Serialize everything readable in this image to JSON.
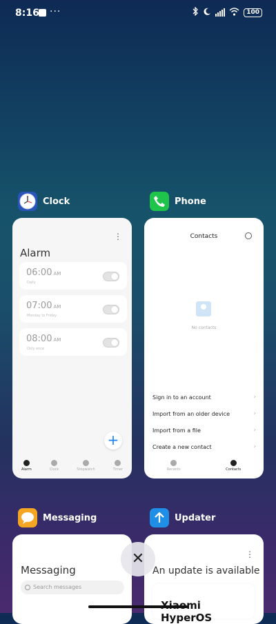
{
  "status_bar": {
    "time": "8:16",
    "dots": "···",
    "battery": "100"
  },
  "apps": [
    {
      "name": "Clock",
      "icon": "clock-icon",
      "card": {
        "title": "Alarm",
        "more": "⋮",
        "alarms": [
          {
            "time": "06:00",
            "ampm": "AM",
            "sub": "Daily"
          },
          {
            "time": "07:00",
            "ampm": "AM",
            "sub": "Monday to Friday"
          },
          {
            "time": "08:00",
            "ampm": "AM",
            "sub": "Only once"
          }
        ],
        "add_label": "+",
        "tabs": [
          "Alarm",
          "Clock",
          "Stopwatch",
          "Timer"
        ],
        "active_tab": "Alarm"
      }
    },
    {
      "name": "Phone",
      "icon": "phone-icon",
      "card": {
        "title": "Contacts",
        "empty_text": "No contacts",
        "menu": [
          "Sign in to an account",
          "Import from an older device",
          "Import from a file",
          "Create a new contact"
        ],
        "tabs": [
          "Recents",
          "Contacts"
        ],
        "active_tab": "Contacts"
      }
    },
    {
      "name": "Messaging",
      "icon": "messaging-icon",
      "card": {
        "title": "Messaging",
        "search_placeholder": "Search messages"
      }
    },
    {
      "name": "Updater",
      "icon": "updater-icon",
      "card": {
        "title": "An update is available",
        "more": "⋮",
        "brand": "Xiaomi HyperOS"
      }
    }
  ],
  "close_label": "✕",
  "colors": {
    "phone": "#1fc44b",
    "messaging": "#f5a623",
    "updater": "#1f8ee6",
    "accent": "#1a7ff0"
  }
}
